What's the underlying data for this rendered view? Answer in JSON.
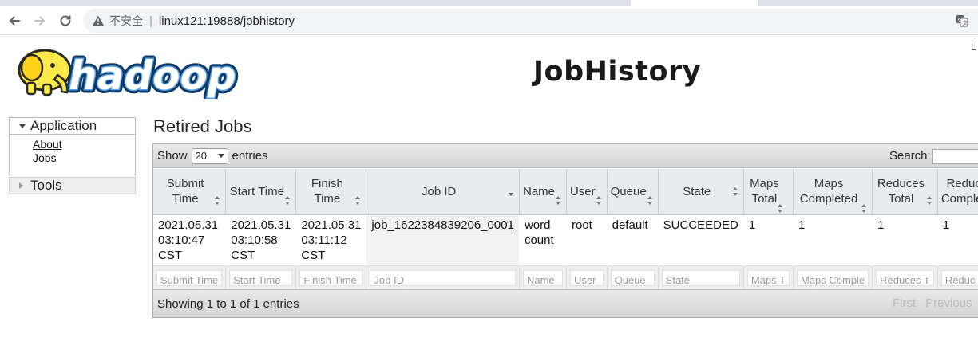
{
  "browser": {
    "insecure_label": "不安全",
    "url": "linux121:19888/jobhistory"
  },
  "header": {
    "title": "JobHistory",
    "corner_text": "L"
  },
  "sidebar": {
    "application_label": "Application",
    "links": [
      "About",
      "Jobs"
    ],
    "tools_label": "Tools"
  },
  "main": {
    "section_title": "Retired Jobs",
    "show_label": "Show",
    "page_length": "20",
    "entries_label": "entries",
    "search_label": "Search:",
    "info_text": "Showing 1 to 1 of 1 entries",
    "pager": {
      "first": "First",
      "previous": "Previous"
    }
  },
  "table": {
    "columns": [
      "Submit Time",
      "Start Time",
      "Finish Time",
      "Job ID",
      "Name",
      "User",
      "Queue",
      "State",
      "Maps Total",
      "Maps Completed",
      "Reduces Total",
      "Reduces Completed"
    ],
    "rows": [
      {
        "submit_time": "2021.05.31 03:10:47 CST",
        "start_time": "2021.05.31 03:10:58 CST",
        "finish_time": "2021.05.31 03:11:12 CST",
        "job_id": "job_1622384839206_0001",
        "name": "word count",
        "user": "root",
        "queue": "default",
        "state": "SUCCEEDED",
        "maps_total": "1",
        "maps_completed": "1",
        "reduces_total": "1",
        "reduces_completed": "1"
      }
    ],
    "filters": [
      "Submit Time",
      "Start Time",
      "Finish Time",
      "Job ID",
      "Name",
      "User",
      "Queue",
      "State",
      "Maps T",
      "Maps Comple",
      "Reduces T",
      "Reduc"
    ]
  }
}
